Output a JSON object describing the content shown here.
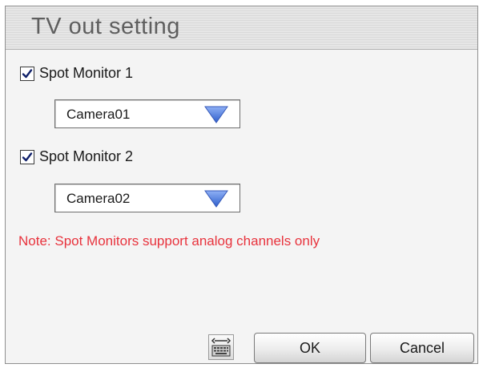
{
  "dialog": {
    "title": "TV out setting"
  },
  "spot_monitor_1": {
    "label": "Spot Monitor 1",
    "checked": true,
    "camera": "Camera01"
  },
  "spot_monitor_2": {
    "label": "Spot Monitor 2",
    "checked": true,
    "camera": "Camera02"
  },
  "note": "Note: Spot Monitors support analog channels only",
  "buttons": {
    "ok_label": "OK",
    "cancel_label": "Cancel"
  },
  "icons": {
    "checkbox_check": "checkmark-icon",
    "dropdown_arrow": "triangle-down-icon",
    "keyboard": "keyboard-icon"
  },
  "colors": {
    "note_text": "#e8333d",
    "dropdown_arrow": "#4a78d8",
    "title_text": "#5e5e5e"
  }
}
